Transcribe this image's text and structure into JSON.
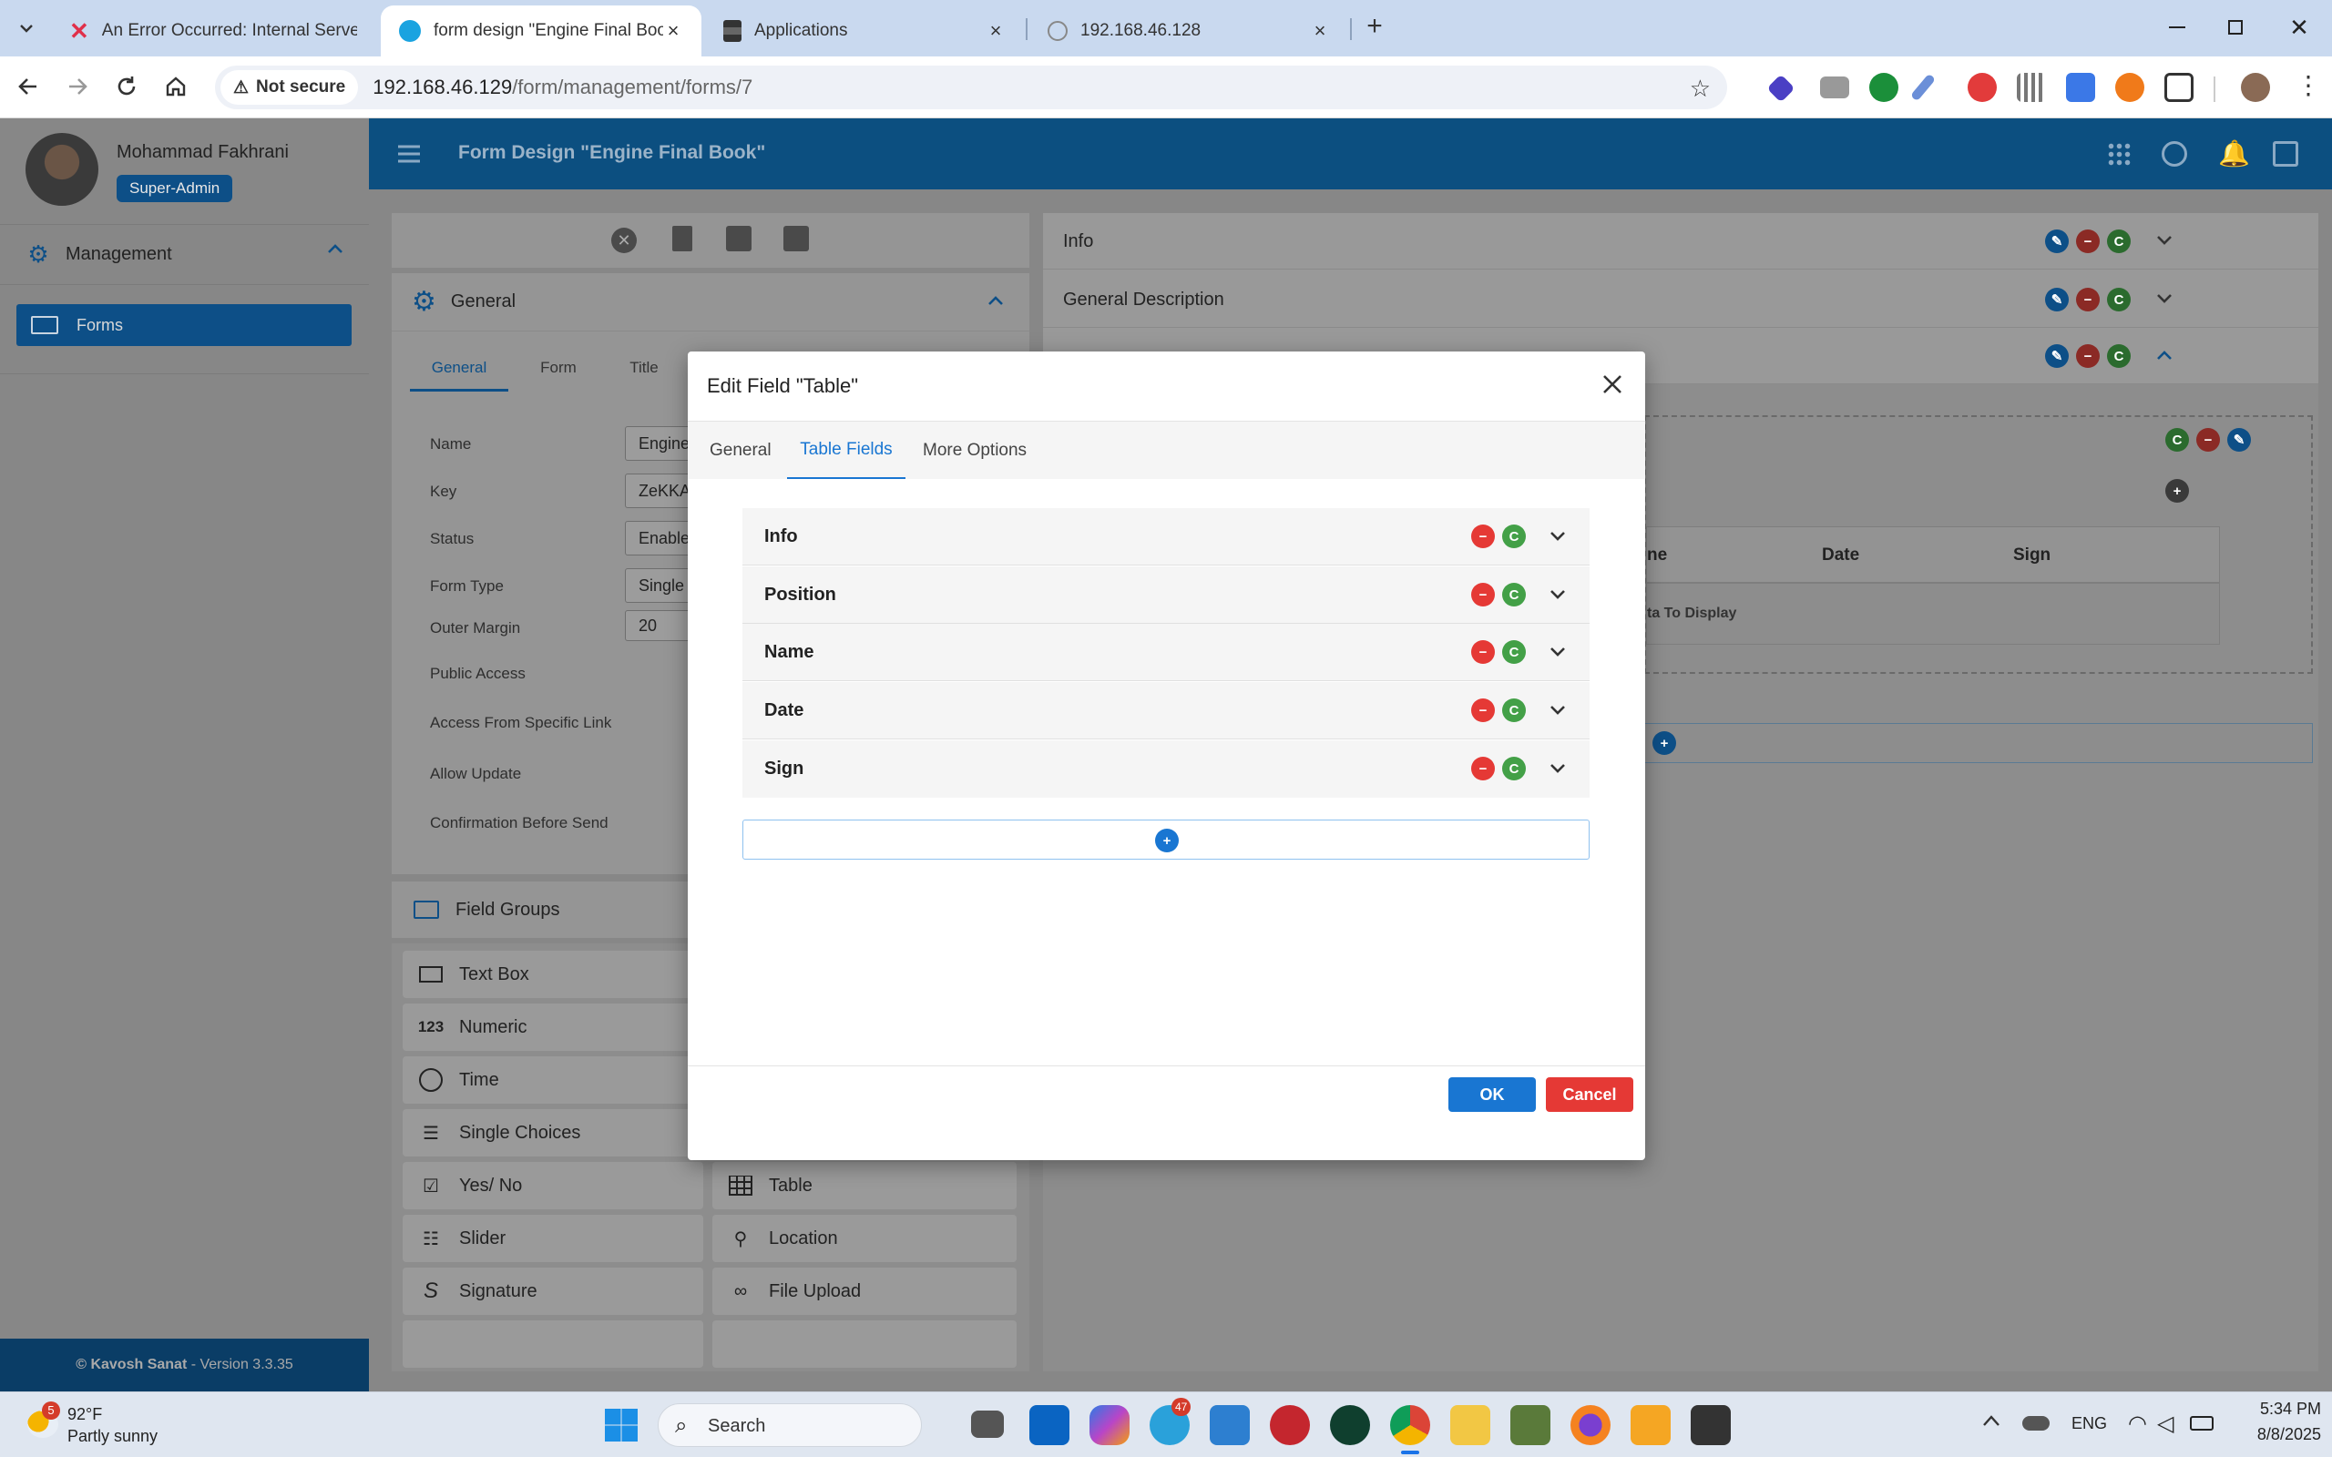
{
  "browser": {
    "tabs": [
      {
        "title": "An Error Occurred: Internal Server Error",
        "icon": "error-x-icon"
      },
      {
        "title": "form design \"Engine Final Book\"",
        "icon": "app-logo-icon"
      },
      {
        "title": "Applications",
        "icon": "figma-icon"
      },
      {
        "title": "192.168.46.128",
        "icon": "globe-icon"
      }
    ],
    "security_label": "Not secure",
    "url_host": "192.168.46.129",
    "url_path": "/form/management/forms/7"
  },
  "user": {
    "name": "Mohammad Fakhrani",
    "role": "Super-Admin"
  },
  "sidebar": {
    "section": "Management",
    "items": [
      {
        "label": "Forms"
      }
    ],
    "footer_brand": "© Kavosh Sanat",
    "footer_version": " - Version 3.3.35"
  },
  "header": {
    "title": "Form Design \"Engine Final Book\""
  },
  "left_panel": {
    "general_title": "General",
    "tabs": [
      "General",
      "Form",
      "Title"
    ],
    "fields": [
      {
        "label": "Name",
        "value": "Engine"
      },
      {
        "label": "Key",
        "value": "ZeKKA"
      },
      {
        "label": "Status",
        "value": "Enable"
      },
      {
        "label": "Form Type",
        "value": "Single"
      },
      {
        "label": "Outer Margin",
        "value": "20"
      }
    ],
    "checkboxes": [
      "Public Access",
      "Access From Specific Link",
      "Allow Update",
      "Confirmation Before Send"
    ],
    "field_groups_title": "Field Groups",
    "tools_left": [
      "Text Box",
      "Numeric",
      "Time",
      "Single Choices",
      "Yes/ No",
      "Slider",
      "Signature"
    ],
    "tools_right": [
      "Table",
      "Location",
      "File Upload"
    ]
  },
  "right_panel": {
    "sections": [
      "Info",
      "General Description"
    ],
    "table_headers": [
      "ne",
      "Date",
      "Sign"
    ],
    "empty_text": "ta To Display"
  },
  "modal": {
    "title": "Edit Field \"Table\"",
    "tabs": [
      "General",
      "Table Fields",
      "More Options"
    ],
    "active_tab": "Table Fields",
    "fields": [
      "Info",
      "Position",
      "Name",
      "Date",
      "Sign"
    ],
    "ok_label": "OK",
    "cancel_label": "Cancel",
    "copy_glyph": "C"
  },
  "colors": {
    "primary": "#1976d2",
    "header": "#0c4f80",
    "danger": "#e53935",
    "success": "#43a047"
  },
  "taskbar": {
    "weather_temp": "92°F",
    "weather_desc": "Partly sunny",
    "weather_badge": "5",
    "search_label": "Search",
    "telegram_badge": "47",
    "lang": "ENG",
    "time": "5:34 PM",
    "date": "8/8/2025"
  }
}
